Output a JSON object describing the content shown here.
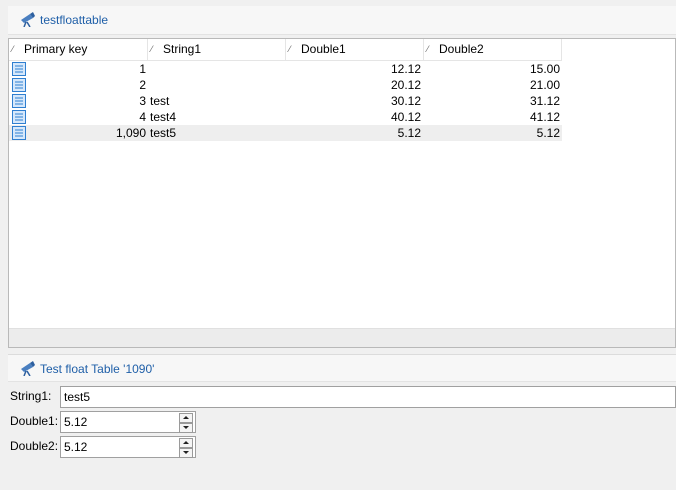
{
  "table_panel": {
    "title": "testfloattable",
    "icon": "telescope-icon"
  },
  "table": {
    "columns": [
      "Primary key",
      "String1",
      "Double1",
      "Double2"
    ],
    "rows": [
      {
        "key": "1",
        "string1": "",
        "double1": "12.12",
        "double2": "15.00"
      },
      {
        "key": "2",
        "string1": "",
        "double1": "20.12",
        "double2": "21.00"
      },
      {
        "key": "3",
        "string1": "test",
        "double1": "30.12",
        "double2": "31.12"
      },
      {
        "key": "4",
        "string1": "test4",
        "double1": "40.12",
        "double2": "41.12"
      },
      {
        "key": "1,090",
        "string1": "test5",
        "double1": "5.12",
        "double2": "5.12"
      }
    ],
    "row_icon": "record-icon"
  },
  "form_panel": {
    "title": "Test float Table '1090'",
    "icon": "telescope-icon"
  },
  "form": {
    "string1": {
      "label": "String1:",
      "value": "test5"
    },
    "double1": {
      "label": "Double1:",
      "value": "5.12"
    },
    "double2": {
      "label": "Double2:",
      "value": "5.12"
    }
  },
  "colors": {
    "accent": "#1f5fa8",
    "row_icon": "#2f7fd0",
    "selected_row": "#eeeeee"
  }
}
